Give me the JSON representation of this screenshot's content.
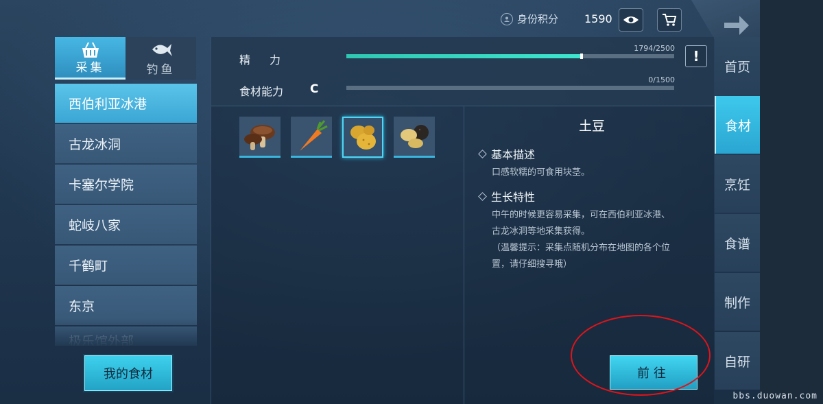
{
  "topbar": {
    "id_score_label": "身份积分",
    "score_value": "1590"
  },
  "mode_tabs": [
    {
      "label": "采集",
      "icon": "basket-icon",
      "active": true
    },
    {
      "label": "钓鱼",
      "icon": "fish-icon",
      "active": false
    }
  ],
  "locations": [
    {
      "label": "西伯利亚冰港",
      "active": true
    },
    {
      "label": "古龙冰洞",
      "active": false
    },
    {
      "label": "卡塞尔学院",
      "active": false
    },
    {
      "label": "蛇岐八家",
      "active": false
    },
    {
      "label": "千鹤町",
      "active": false
    },
    {
      "label": "东京",
      "active": false
    },
    {
      "label": "极乐馆外部",
      "active": false
    }
  ],
  "my_food_button": "我的食材",
  "stats": {
    "stamina_label": "精力",
    "stamina_text": "1794/2500",
    "stamina_fraction": 0.7176,
    "ability_label": "食材能力",
    "ability_grade": "C",
    "ability_text": "0/1500",
    "ability_fraction": 0,
    "alert_icon": "!"
  },
  "ingredients": [
    {
      "name": "mushroom",
      "icon": "mushroom-icon",
      "selected": false
    },
    {
      "name": "carrot",
      "icon": "carrot-icon",
      "selected": false
    },
    {
      "name": "potato",
      "icon": "potato-icon",
      "selected": true
    },
    {
      "name": "truffle",
      "icon": "truffle-icon",
      "selected": false
    }
  ],
  "detail": {
    "title": "土豆",
    "section1_title": "基本描述",
    "section1_body": "口感软糯的可食用块茎。",
    "section2_title": "生长特性",
    "section2_line1": "中午的时候更容易采集，可在西伯利亚冰港、",
    "section2_line2": "古龙冰洞等地采集获得。",
    "section2_line3": "（温馨提示：采集点随机分布在地图的各个位",
    "section2_line4": "置，请仔细搜寻哦）",
    "go_button": "前往"
  },
  "right_tabs": [
    {
      "label": "首页",
      "active": false
    },
    {
      "label": "食材",
      "active": true
    },
    {
      "label": "烹饪",
      "active": false
    },
    {
      "label": "食谱",
      "active": false
    },
    {
      "label": "制作",
      "active": false
    },
    {
      "label": "自研",
      "active": false
    }
  ],
  "watermark": "bbs.duowan.com",
  "colors": {
    "accent": "#3ec8ec",
    "stamina_fill": "#3ee6cf",
    "highlight_ring": "#e0141a"
  }
}
